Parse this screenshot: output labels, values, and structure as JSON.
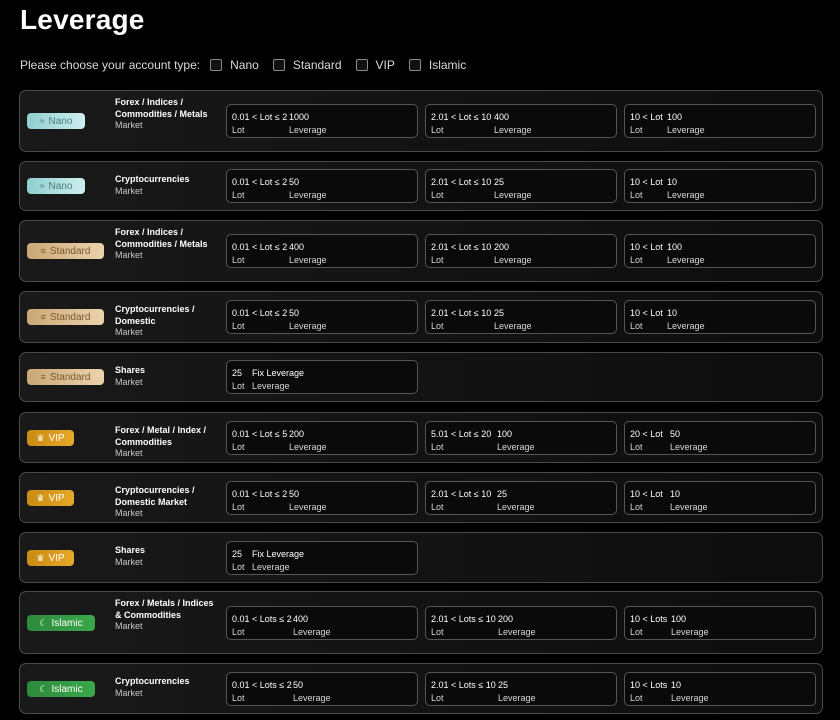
{
  "title": "Leverage",
  "chooser": {
    "prompt": "Please choose your account type:",
    "options": [
      "Nano",
      "Standard",
      "VIP",
      "Islamic"
    ]
  },
  "icons": {
    "Nano": "wave-icon",
    "Standard": "layers-icon",
    "VIP": "crown-icon",
    "Islamic": "crescent-icon"
  },
  "rows": [
    {
      "account": "Nano",
      "market": "Forex / Indices / Commodities / Metals",
      "market_label": "Market",
      "tiers": [
        {
          "lot": "0.01 < Lot ≤ 2",
          "lev": "1000",
          "lot_label": "Lot",
          "lev_label": "Leverage"
        },
        {
          "lot": "2.01 < Lot ≤ 10",
          "lev": "400",
          "lot_label": "Lot",
          "lev_label": "Leverage"
        },
        {
          "lot": "10 < Lot",
          "lev": "100",
          "lot_label": "Lot",
          "lev_label": "Leverage"
        }
      ]
    },
    {
      "account": "Nano",
      "market": "Cryptocurrencies",
      "market_label": "Market",
      "tiers": [
        {
          "lot": "0.01 < Lot ≤ 2",
          "lev": "50",
          "lot_label": "Lot",
          "lev_label": "Leverage"
        },
        {
          "lot": "2.01 < Lot ≤ 10",
          "lev": "25",
          "lot_label": "Lot",
          "lev_label": "Leverage"
        },
        {
          "lot": "10 < Lot",
          "lev": "10",
          "lot_label": "Lot",
          "lev_label": "Leverage"
        }
      ]
    },
    {
      "account": "Standard",
      "market": "Forex / Indices / Commodities / Metals",
      "market_label": "Market",
      "tiers": [
        {
          "lot": "0.01 < Lot ≤ 2",
          "lev": "400",
          "lot_label": "Lot",
          "lev_label": "Leverage"
        },
        {
          "lot": "2.01 < Lot ≤ 10",
          "lev": "200",
          "lot_label": "Lot",
          "lev_label": "Leverage"
        },
        {
          "lot": "10 < Lot",
          "lev": "100",
          "lot_label": "Lot",
          "lev_label": "Leverage"
        }
      ]
    },
    {
      "account": "Standard",
      "market": "Cryptocurrencies / Domestic",
      "market_label": "Market",
      "tiers": [
        {
          "lot": "0.01 < Lot ≤ 2",
          "lev": "50",
          "lot_label": "Lot",
          "lev_label": "Leverage"
        },
        {
          "lot": "2.01 < Lot ≤ 10",
          "lev": "25",
          "lot_label": "Lot",
          "lev_label": "Leverage"
        },
        {
          "lot": "10 < Lot",
          "lev": "10",
          "lot_label": "Lot",
          "lev_label": "Leverage"
        }
      ]
    },
    {
      "account": "Standard",
      "market": "Shares",
      "market_label": "Market",
      "tiers": [
        {
          "lot": "25",
          "lev": "Fix Leverage",
          "lot_label": "Lot",
          "lev_label": "Leverage"
        }
      ]
    },
    {
      "account": "VIP",
      "market": "Forex / Metal / Index / Commodities",
      "market_label": "Market",
      "tiers": [
        {
          "lot": "0.01 < Lot ≤ 5",
          "lev": "200",
          "lot_label": "Lot",
          "lev_label": "Leverage"
        },
        {
          "lot": "5.01 < Lot ≤ 20",
          "lev": "100",
          "lot_label": "Lot",
          "lev_label": "Leverage"
        },
        {
          "lot": "20 < Lot",
          "lev": "50",
          "lot_label": "Lot",
          "lev_label": "Leverage"
        }
      ]
    },
    {
      "account": "VIP",
      "market": "Cryptocurrencies / Domestic Market",
      "market_label": "Market",
      "tiers": [
        {
          "lot": "0.01 < Lot ≤ 2",
          "lev": "50",
          "lot_label": "Lot",
          "lev_label": "Leverage"
        },
        {
          "lot": "2.01 < Lot ≤ 10",
          "lev": "25",
          "lot_label": "Lot",
          "lev_label": "Leverage"
        },
        {
          "lot": "10 < Lot",
          "lev": "10",
          "lot_label": "Lot",
          "lev_label": "Leverage"
        }
      ]
    },
    {
      "account": "VIP",
      "market": "Shares",
      "market_label": "Market",
      "tiers": [
        {
          "lot": "25",
          "lev": "Fix Leverage",
          "lot_label": "Lot",
          "lev_label": "Leverage"
        }
      ]
    },
    {
      "account": "Islamic",
      "market": "Forex / Metals / Indices & Commodities",
      "market_label": "Market",
      "tiers": [
        {
          "lot": "0.01 < Lots ≤ 2",
          "lev": "400",
          "lot_label": "Lot",
          "lev_label": "Leverage"
        },
        {
          "lot": "2.01 < Lots ≤ 10",
          "lev": "200",
          "lot_label": "Lot",
          "lev_label": "Leverage"
        },
        {
          "lot": "10 < Lots",
          "lev": "100",
          "lot_label": "Lot",
          "lev_label": "Leverage"
        }
      ]
    },
    {
      "account": "Islamic",
      "market": "Cryptocurrencies",
      "market_label": "Market",
      "tiers": [
        {
          "lot": "0.01 < Lots ≤ 2",
          "lev": "50",
          "lot_label": "Lot",
          "lev_label": "Leverage"
        },
        {
          "lot": "2.01 < Lots ≤ 10",
          "lev": "25",
          "lot_label": "Lot",
          "lev_label": "Leverage"
        },
        {
          "lot": "10 < Lots",
          "lev": "10",
          "lot_label": "Lot",
          "lev_label": "Leverage"
        }
      ]
    }
  ]
}
